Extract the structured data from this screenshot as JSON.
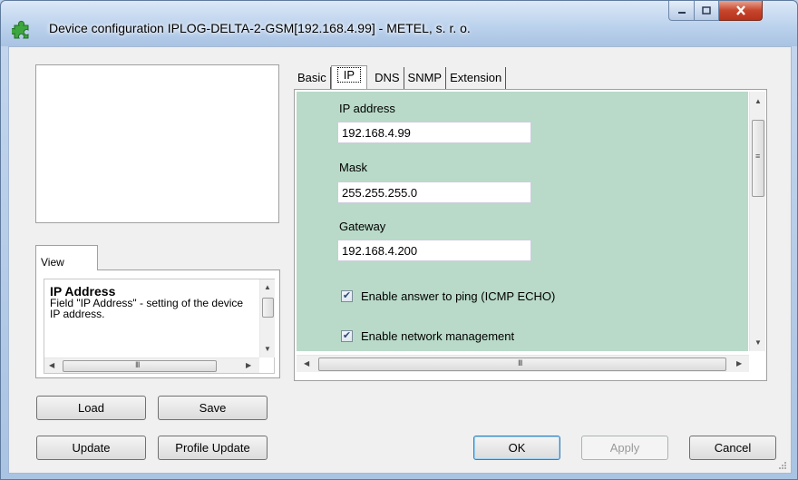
{
  "window": {
    "title": "Device configuration IPLOG-DELTA-2-GSM[192.168.4.99] - METEL, s. r. o.",
    "app_icon": "green-puzzle-icon"
  },
  "left": {
    "view_tab_label": "View",
    "help": {
      "title": "IP Address",
      "body": "Field \"IP Address\" - setting of the device IP address."
    },
    "buttons": {
      "load": "Load",
      "save": "Save",
      "update": "Update",
      "profile_update": "Profile Update"
    }
  },
  "tabs": [
    {
      "label": "Basic",
      "active": false
    },
    {
      "label": "IP",
      "active": true
    },
    {
      "label": "DNS",
      "active": false
    },
    {
      "label": "SNMP",
      "active": false
    },
    {
      "label": "Extension",
      "active": false
    }
  ],
  "ip_form": {
    "ip_label": "IP address",
    "ip_value": "192.168.4.99",
    "mask_label": "Mask",
    "mask_value": "255.255.255.0",
    "gateway_label": "Gateway",
    "gateway_value": "192.168.4.200",
    "ping_label": "Enable answer to ping (ICMP ECHO)",
    "ping_checked": true,
    "mgmt_label": "Enable network management",
    "mgmt_checked": true
  },
  "dialog_buttons": {
    "ok": "OK",
    "apply": "Apply",
    "cancel": "Cancel"
  },
  "colors": {
    "panel_green": "#b9dac9",
    "titlebar": "#bcd2ed",
    "close_red": "#c7462c"
  }
}
